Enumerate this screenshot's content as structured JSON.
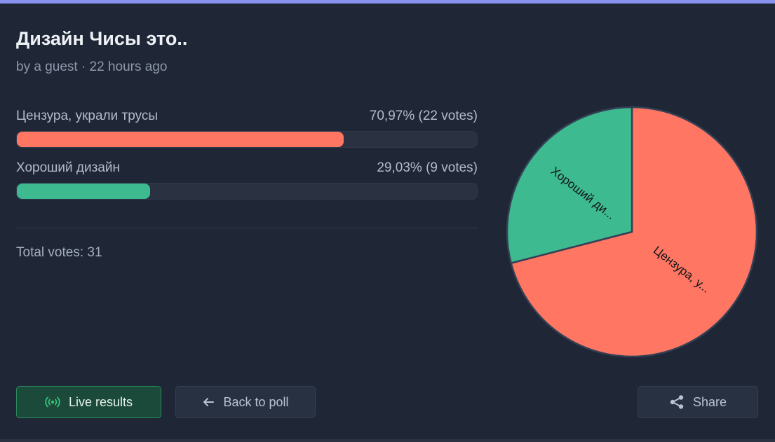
{
  "poll": {
    "title": "Дизайн Чисы это..",
    "meta": "by a guest · 22 hours ago",
    "total_votes_text": "Total votes: 31"
  },
  "options": [
    {
      "label": "Цензура, украли трусы",
      "stat": "70,97% (22 votes)",
      "percent": 70.97,
      "votes": 22,
      "color": "#ff7663"
    },
    {
      "label": "Хороший дизайн",
      "stat": "29,03% (9 votes)",
      "percent": 29.03,
      "votes": 9,
      "color": "#3dba90"
    }
  ],
  "chart_data": {
    "type": "pie",
    "categories": [
      "Цензура, украли трусы",
      "Хороший дизайн"
    ],
    "values": [
      22,
      9
    ],
    "slice_labels": [
      "Цензура, у...",
      "Хороший ди..."
    ],
    "colors": [
      "#ff7663",
      "#3dba90"
    ]
  },
  "buttons": {
    "live": "Live results",
    "back": "Back to poll",
    "share": "Share"
  },
  "icons": {
    "live": "broadcast-icon",
    "back": "arrow-left-icon",
    "share": "share-icon"
  }
}
